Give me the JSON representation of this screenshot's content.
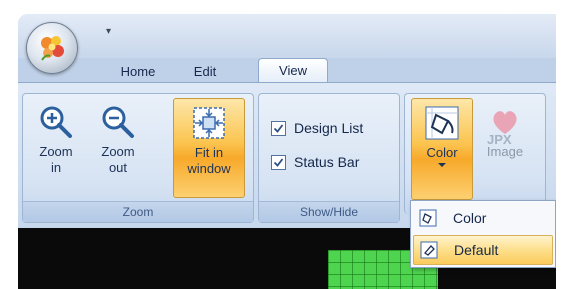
{
  "tabs": {
    "home": "Home",
    "edit": "Edit",
    "view": "View"
  },
  "qat_glyph": "▾",
  "groups": {
    "zoom": {
      "label": "Zoom",
      "zoom_in": "Zoom\nin",
      "zoom_in_l1": "Zoom",
      "zoom_in_l2": "in",
      "zoom_out_l1": "Zoom",
      "zoom_out_l2": "out",
      "fit_l1": "Fit in",
      "fit_l2": "window"
    },
    "show_hide": {
      "label": "Show/Hide",
      "design_list": "Design List",
      "status_bar": "Status Bar",
      "design_list_checked": true,
      "status_bar_checked": true
    },
    "color": {
      "color_label": "Color",
      "image_label": "Image",
      "jpx_text": "JPX"
    }
  },
  "menu": {
    "items": [
      {
        "label": "Color",
        "icon": "paint-bucket-icon"
      },
      {
        "label": "Default",
        "icon": "eraser-icon"
      }
    ]
  },
  "colors": {
    "accent_orange": "#fbc44f",
    "ribbon_blue": "#c6d7ed",
    "grid_green": "#4fd44f"
  }
}
